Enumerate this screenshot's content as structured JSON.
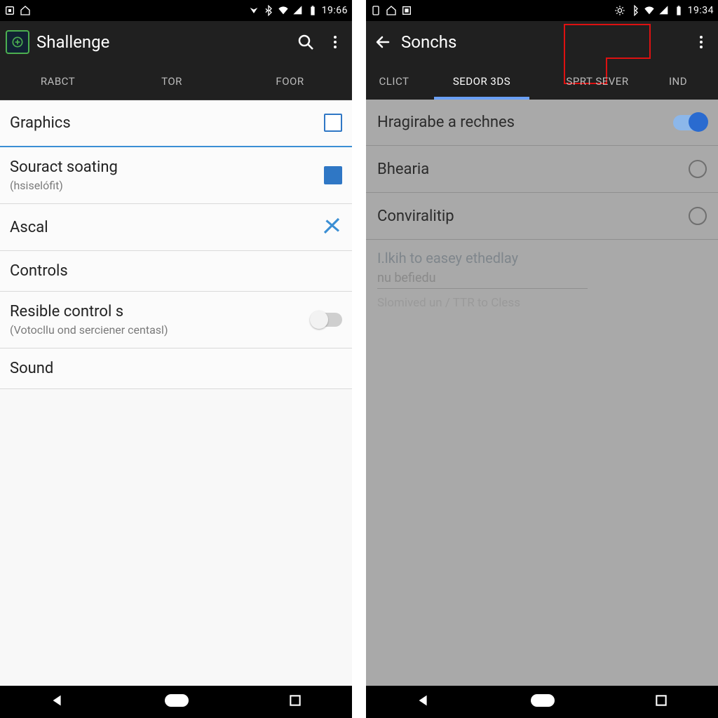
{
  "status": {
    "time_left": "19:66",
    "time_right": "19:34"
  },
  "left": {
    "appbar": {
      "title": "Shallenge"
    },
    "tabs": [
      "RABCT",
      "TOR",
      "FOOR"
    ],
    "rows": {
      "graphics": {
        "title": "Graphics"
      },
      "souract": {
        "title": "Souract soating",
        "sub": "(hsiselófit)"
      },
      "ascal": {
        "title": "Ascal"
      },
      "controls": {
        "title": "Controls"
      },
      "resible": {
        "title": "Resible control s",
        "sub": "(Votocllu ond serciener centasl)"
      },
      "sound": {
        "title": "Sound"
      }
    }
  },
  "right": {
    "appbar": {
      "title": "Sonchs"
    },
    "tabs": [
      "CLICT",
      "SEDOR 3DS",
      "SPRT SEVER",
      "IND"
    ],
    "rows": {
      "hrag": {
        "title": "Hragirabe a rechnes"
      },
      "bhearia": {
        "title": "Bhearia"
      },
      "conv": {
        "title": "Conviralitip"
      }
    },
    "sub": {
      "l1": "I.lkih to easey ethedlay",
      "l2": "nu befiedu",
      "l3": "Slomived un / TTR to Cless"
    }
  }
}
